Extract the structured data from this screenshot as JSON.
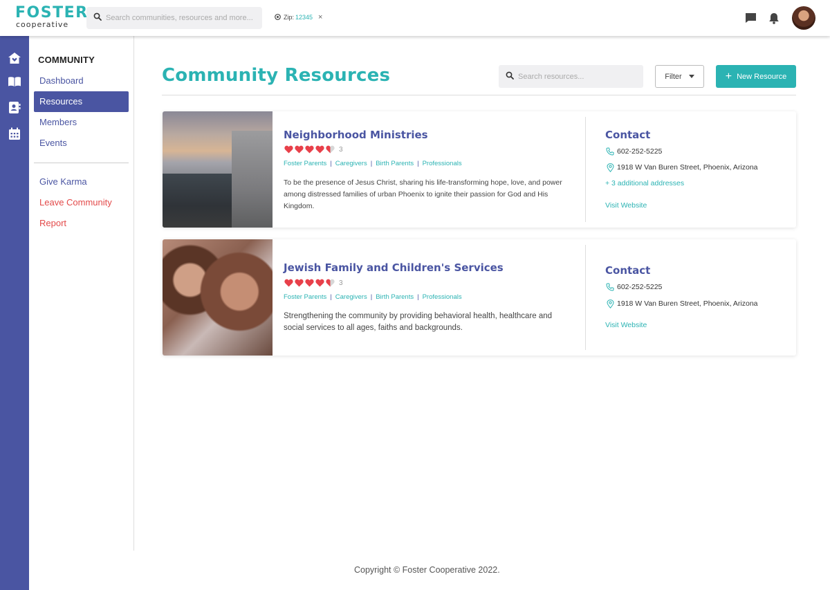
{
  "app": {
    "logo_main": "FOSTER",
    "logo_sub": "cooperative"
  },
  "topbar": {
    "search_placeholder": "Search communities, resources and more...",
    "zip_label": "Zip:",
    "zip_value": "12345",
    "zip_close": "×"
  },
  "sidebar": {
    "heading": "COMMUNITY",
    "items": [
      {
        "label": "Dashboard",
        "active": false
      },
      {
        "label": "Resources",
        "active": true
      },
      {
        "label": "Members",
        "active": false
      },
      {
        "label": "Events",
        "active": false
      }
    ],
    "secondary": [
      {
        "label": "Give Karma"
      },
      {
        "label": "Leave Community"
      },
      {
        "label": "Report"
      }
    ]
  },
  "main": {
    "title": "Community Resources",
    "search_placeholder": "Search resources...",
    "filter_label": "Filter",
    "new_button_label": "New Resource"
  },
  "resources": [
    {
      "name": "Neighborhood Ministries",
      "rating": 4.5,
      "rating_count": "3",
      "tags": [
        "Foster Parents",
        "Caregivers",
        "Birth Parents",
        "Professionals"
      ],
      "description": "To be the presence of Jesus Christ, sharing his life-transforming hope, love, and power among distressed families of urban Phoenix to ignite their passion for God and His Kingdom.",
      "contact_title": "Contact",
      "phone": "602-252-5225",
      "address": "1918 W Van Buren Street, Phoenix, Arizona",
      "additional": "+ 3 additional addresses",
      "website_label": "Visit Website"
    },
    {
      "name": "Jewish Family and Children's Services",
      "rating": 4.5,
      "rating_count": "3",
      "tags": [
        "Foster Parents",
        "Caregivers",
        "Birth Parents",
        "Professionals"
      ],
      "description": "Strengthening the community by providing behavioral health, healthcare and social services to all ages, faiths and backgrounds.",
      "contact_title": "Contact",
      "phone": "602-252-5225",
      "address": "1918 W Van Buren Street, Phoenix, Arizona",
      "website_label": "Visit Website"
    }
  ],
  "footer": {
    "copyright": "Copyright © Foster Cooperative 2022."
  },
  "colors": {
    "brand_teal": "#2bb3b3",
    "brand_indigo": "#4a55a2",
    "danger": "#e34a4a",
    "heart": "#e8404a"
  }
}
